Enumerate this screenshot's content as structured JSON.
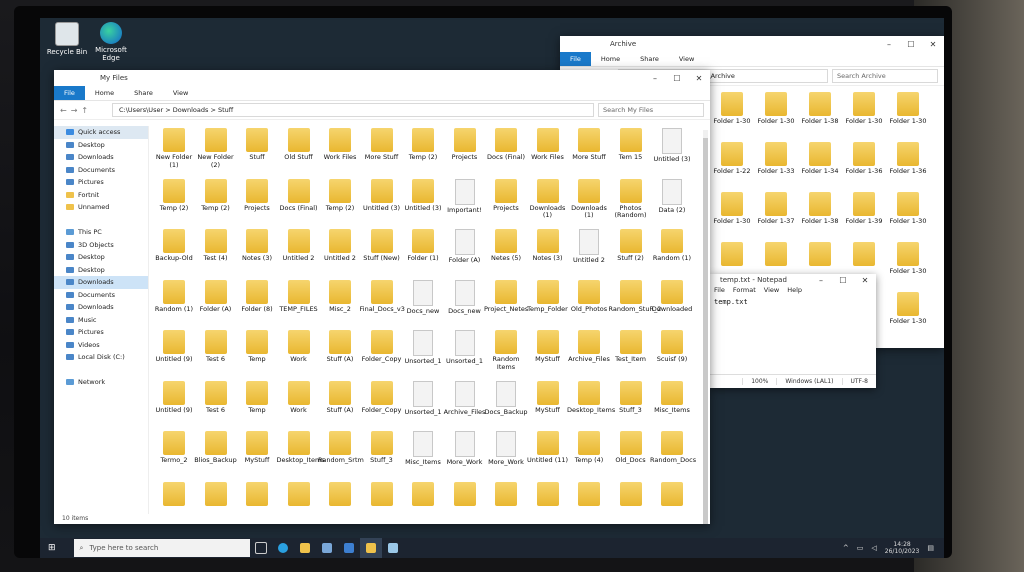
{
  "desktop": {
    "icons": [
      {
        "label": "Recycle Bin",
        "icon": "recycle-bin-icon"
      },
      {
        "label": "Microsoft Edge",
        "icon": "edge-icon"
      }
    ]
  },
  "archive_window": {
    "title": "Archive",
    "tabs": [
      "File",
      "Home",
      "Share",
      "View"
    ],
    "address": "C:\\Users\\User\\Documents\\Archive",
    "search_placeholder": "Search Archive",
    "items": [
      "Folder 1-30",
      "Folder 1-30",
      "Folder 1-38",
      "Folder 1-30",
      "Folder 1-30",
      "Folder 1-22",
      "Folder 1-33",
      "Folder 1-34",
      "Folder 1-36",
      "Folder 1-36",
      "Folder 1-30",
      "Folder 1-37",
      "Folder 1-38",
      "Folder 1-39",
      "Folder 1-30",
      "",
      "",
      "",
      "",
      "Folder 1-30",
      "",
      "",
      "",
      "",
      "Folder 1-30"
    ]
  },
  "main_window": {
    "title": "My Files",
    "tabs": [
      "File",
      "Home",
      "Share",
      "View"
    ],
    "address": "C:\\Users\\User  >  Downloads  >  Stuff",
    "search_placeholder": "Search My Files",
    "status": "10 items",
    "sidebar": [
      {
        "label": "Quick access",
        "type": "head"
      },
      {
        "label": "Desktop",
        "type": "pin"
      },
      {
        "label": "Downloads",
        "type": "pin"
      },
      {
        "label": "Documents",
        "type": "pin"
      },
      {
        "label": "Pictures",
        "type": "pin"
      },
      {
        "label": "Fortnit",
        "type": "folder"
      },
      {
        "label": "Unnamed",
        "type": "folder"
      },
      {
        "label": "",
        "type": "gap"
      },
      {
        "label": "This PC",
        "type": "pc"
      },
      {
        "label": "3D Objects",
        "type": "item"
      },
      {
        "label": "Desktop",
        "type": "item"
      },
      {
        "label": "Desktop",
        "type": "item"
      },
      {
        "label": "Downloads",
        "type": "sel"
      },
      {
        "label": "Documents",
        "type": "item"
      },
      {
        "label": "Downloads",
        "type": "item"
      },
      {
        "label": "Music",
        "type": "item"
      },
      {
        "label": "Pictures",
        "type": "item"
      },
      {
        "label": "Videos",
        "type": "item"
      },
      {
        "label": "Local Disk (C:)",
        "type": "item"
      },
      {
        "label": "",
        "type": "gap"
      },
      {
        "label": "Network",
        "type": "net"
      }
    ],
    "items": [
      [
        "New Folder (1)",
        "New Folder (2)",
        "Stuff",
        "Old Stuff",
        "Work Files",
        "More Stuff",
        "Temp (2)",
        "Projects",
        "Docs (Final)",
        "Work Files",
        "More Stuff",
        "Tem 15",
        "Untitled (3)"
      ],
      [
        "Temp (2)",
        "Temp (2)",
        "Projects",
        "Docs (Final)",
        "Temp (2)",
        "Untitled (3)",
        "Untitled (3)",
        "Important!",
        "Projects",
        "Downloads (1)",
        "Downloads (1)",
        "Photos (Random)",
        "Data (2)"
      ],
      [
        "Backup-Old",
        "Test (4)",
        "Notes (3)",
        "Untitled 2",
        "Untitled 2",
        "Stuff (New)",
        "Folder (1)",
        "Folder (A)",
        "Netes (5)",
        "Notes (3)",
        "Untitled 2",
        "Stuff (2)",
        "Random (1)"
      ],
      [
        "Random (1)",
        "Folder (A)",
        "Folder (8)",
        "TEMP_FILES",
        "Misc_2",
        "Final_Docs_v3",
        "Docs_new",
        "Docs_new",
        "Project_Netes",
        "Temp_Folder",
        "Old_Photos",
        "Random_StuR_2",
        "Downloaded"
      ],
      [
        "Untitled (9)",
        "Test 6",
        "Temp",
        "Work",
        "Stuff (A)",
        "Folder_Copy",
        "Unsorted_1",
        "Unsorted_1",
        "Random Items",
        "MyStuff",
        "Archive_Files",
        "Test_Item",
        "Scuisf (9)"
      ],
      [
        "Untitled (9)",
        "Test 6",
        "Temp",
        "Work",
        "Stuff (A)",
        "Folder_Copy",
        "Unsorted_1",
        "Archive_Files",
        "Docs_Backup",
        "MyStuff",
        "Desktop_Items",
        "Stuff_3",
        "Misc_Items"
      ],
      [
        "Termo_2",
        "Blios_Backup",
        "MyStuff",
        "Desktop_Items",
        "Random_Srtm",
        "Stuff_3",
        "Misc_Items",
        "More_Work",
        "More_Work",
        "Untitled (11)",
        "Temp (4)",
        "Old_Docs",
        "Random_Docs"
      ],
      [
        "",
        "",
        "",
        "",
        "",
        "",
        "",
        "",
        "",
        "",
        "",
        "",
        ""
      ]
    ],
    "doc_positions": [
      [
        0,
        12
      ],
      [
        1,
        7
      ],
      [
        1,
        12
      ],
      [
        2,
        7
      ],
      [
        2,
        10
      ],
      [
        3,
        6
      ],
      [
        3,
        7
      ],
      [
        4,
        6
      ],
      [
        4,
        7
      ],
      [
        5,
        6
      ],
      [
        5,
        7
      ],
      [
        5,
        8
      ],
      [
        6,
        6
      ],
      [
        6,
        7
      ],
      [
        6,
        8
      ]
    ]
  },
  "notepad": {
    "title": "temp.txt - Notepad",
    "menu": [
      "File",
      "Format",
      "View",
      "Help"
    ],
    "text": "temp.txt",
    "status": [
      "100%",
      "Windows (LAL1)",
      "UTF-8"
    ]
  },
  "taskbar": {
    "search_placeholder": "Type here to search",
    "time": "14:28",
    "date": "26/10/2023"
  },
  "colors": {
    "accent": "#1979ca",
    "folder": "#efc24b",
    "taskbar": "#1c2430"
  }
}
